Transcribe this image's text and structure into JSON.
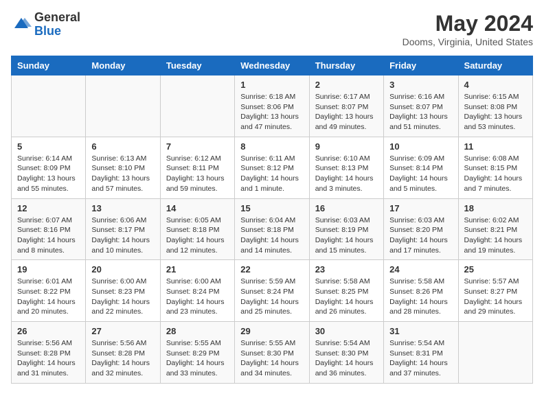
{
  "header": {
    "logo_general": "General",
    "logo_blue": "Blue",
    "main_title": "May 2024",
    "subtitle": "Dooms, Virginia, United States"
  },
  "calendar": {
    "columns": [
      "Sunday",
      "Monday",
      "Tuesday",
      "Wednesday",
      "Thursday",
      "Friday",
      "Saturday"
    ],
    "rows": [
      [
        {
          "day": "",
          "info": ""
        },
        {
          "day": "",
          "info": ""
        },
        {
          "day": "",
          "info": ""
        },
        {
          "day": "1",
          "info": "Sunrise: 6:18 AM\nSunset: 8:06 PM\nDaylight: 13 hours and 47 minutes."
        },
        {
          "day": "2",
          "info": "Sunrise: 6:17 AM\nSunset: 8:07 PM\nDaylight: 13 hours and 49 minutes."
        },
        {
          "day": "3",
          "info": "Sunrise: 6:16 AM\nSunset: 8:07 PM\nDaylight: 13 hours and 51 minutes."
        },
        {
          "day": "4",
          "info": "Sunrise: 6:15 AM\nSunset: 8:08 PM\nDaylight: 13 hours and 53 minutes."
        }
      ],
      [
        {
          "day": "5",
          "info": "Sunrise: 6:14 AM\nSunset: 8:09 PM\nDaylight: 13 hours and 55 minutes."
        },
        {
          "day": "6",
          "info": "Sunrise: 6:13 AM\nSunset: 8:10 PM\nDaylight: 13 hours and 57 minutes."
        },
        {
          "day": "7",
          "info": "Sunrise: 6:12 AM\nSunset: 8:11 PM\nDaylight: 13 hours and 59 minutes."
        },
        {
          "day": "8",
          "info": "Sunrise: 6:11 AM\nSunset: 8:12 PM\nDaylight: 14 hours and 1 minute."
        },
        {
          "day": "9",
          "info": "Sunrise: 6:10 AM\nSunset: 8:13 PM\nDaylight: 14 hours and 3 minutes."
        },
        {
          "day": "10",
          "info": "Sunrise: 6:09 AM\nSunset: 8:14 PM\nDaylight: 14 hours and 5 minutes."
        },
        {
          "day": "11",
          "info": "Sunrise: 6:08 AM\nSunset: 8:15 PM\nDaylight: 14 hours and 7 minutes."
        }
      ],
      [
        {
          "day": "12",
          "info": "Sunrise: 6:07 AM\nSunset: 8:16 PM\nDaylight: 14 hours and 8 minutes."
        },
        {
          "day": "13",
          "info": "Sunrise: 6:06 AM\nSunset: 8:17 PM\nDaylight: 14 hours and 10 minutes."
        },
        {
          "day": "14",
          "info": "Sunrise: 6:05 AM\nSunset: 8:18 PM\nDaylight: 14 hours and 12 minutes."
        },
        {
          "day": "15",
          "info": "Sunrise: 6:04 AM\nSunset: 8:18 PM\nDaylight: 14 hours and 14 minutes."
        },
        {
          "day": "16",
          "info": "Sunrise: 6:03 AM\nSunset: 8:19 PM\nDaylight: 14 hours and 15 minutes."
        },
        {
          "day": "17",
          "info": "Sunrise: 6:03 AM\nSunset: 8:20 PM\nDaylight: 14 hours and 17 minutes."
        },
        {
          "day": "18",
          "info": "Sunrise: 6:02 AM\nSunset: 8:21 PM\nDaylight: 14 hours and 19 minutes."
        }
      ],
      [
        {
          "day": "19",
          "info": "Sunrise: 6:01 AM\nSunset: 8:22 PM\nDaylight: 14 hours and 20 minutes."
        },
        {
          "day": "20",
          "info": "Sunrise: 6:00 AM\nSunset: 8:23 PM\nDaylight: 14 hours and 22 minutes."
        },
        {
          "day": "21",
          "info": "Sunrise: 6:00 AM\nSunset: 8:24 PM\nDaylight: 14 hours and 23 minutes."
        },
        {
          "day": "22",
          "info": "Sunrise: 5:59 AM\nSunset: 8:24 PM\nDaylight: 14 hours and 25 minutes."
        },
        {
          "day": "23",
          "info": "Sunrise: 5:58 AM\nSunset: 8:25 PM\nDaylight: 14 hours and 26 minutes."
        },
        {
          "day": "24",
          "info": "Sunrise: 5:58 AM\nSunset: 8:26 PM\nDaylight: 14 hours and 28 minutes."
        },
        {
          "day": "25",
          "info": "Sunrise: 5:57 AM\nSunset: 8:27 PM\nDaylight: 14 hours and 29 minutes."
        }
      ],
      [
        {
          "day": "26",
          "info": "Sunrise: 5:56 AM\nSunset: 8:28 PM\nDaylight: 14 hours and 31 minutes."
        },
        {
          "day": "27",
          "info": "Sunrise: 5:56 AM\nSunset: 8:28 PM\nDaylight: 14 hours and 32 minutes."
        },
        {
          "day": "28",
          "info": "Sunrise: 5:55 AM\nSunset: 8:29 PM\nDaylight: 14 hours and 33 minutes."
        },
        {
          "day": "29",
          "info": "Sunrise: 5:55 AM\nSunset: 8:30 PM\nDaylight: 14 hours and 34 minutes."
        },
        {
          "day": "30",
          "info": "Sunrise: 5:54 AM\nSunset: 8:30 PM\nDaylight: 14 hours and 36 minutes."
        },
        {
          "day": "31",
          "info": "Sunrise: 5:54 AM\nSunset: 8:31 PM\nDaylight: 14 hours and 37 minutes."
        },
        {
          "day": "",
          "info": ""
        }
      ]
    ]
  }
}
